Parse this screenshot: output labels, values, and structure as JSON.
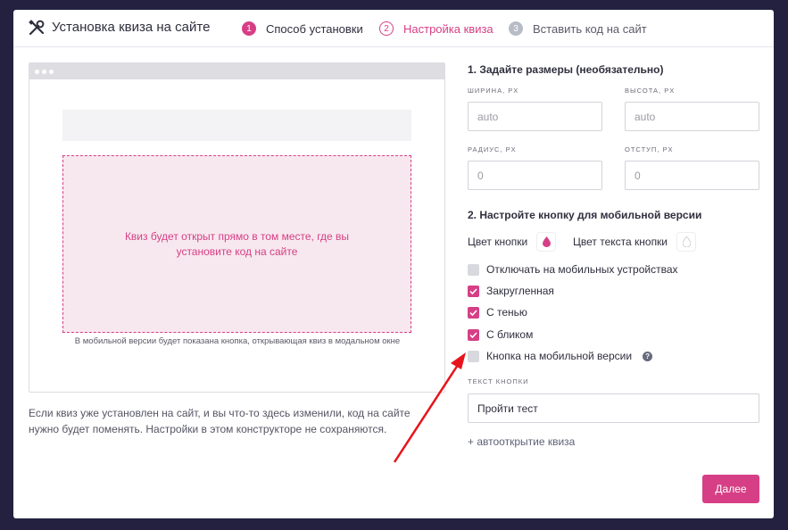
{
  "header": {
    "title": "Установка квиза на сайте",
    "steps": [
      {
        "num": "1",
        "label": "Способ установки"
      },
      {
        "num": "2",
        "label": "Настройка квиза"
      },
      {
        "num": "3",
        "label": "Вставить код на сайт"
      }
    ]
  },
  "preview": {
    "quiz_text": "Квиз будет открыт прямо в том месте, где вы установите код на сайте",
    "mobile_note": "В мобильной версии будет показана кнопка, открывающая квиз в модальном окне",
    "footer_note": "Если квиз уже установлен на сайт, и вы что-то здесь изменили, код на сайте нужно будет поменять. Настройки в этом конструкторе не сохраняются."
  },
  "sizes": {
    "title": "1. Задайте размеры (необязательно)",
    "width_label": "ширина, px",
    "width_placeholder": "auto",
    "height_label": "высота, px",
    "height_placeholder": "auto",
    "radius_label": "радиус, px",
    "radius_placeholder": "0",
    "offset_label": "отступ, px",
    "offset_placeholder": "0"
  },
  "mobile": {
    "title": "2. Настройте кнопку для мобильной версии",
    "button_color_label": "Цвет кнопки",
    "button_color": "#d63f85",
    "text_color_label": "Цвет текста кнопки",
    "text_color": "#ffffff",
    "options": [
      {
        "label": "Отключать на мобильных устройствах",
        "checked": false
      },
      {
        "label": "Закругленная",
        "checked": true
      },
      {
        "label": "С тенью",
        "checked": true
      },
      {
        "label": "С бликом",
        "checked": true
      },
      {
        "label": "Кнопка на мобильной версии",
        "checked": false
      }
    ],
    "button_text_label": "текст кнопки",
    "button_text_value": "Пройти тест",
    "autoopen_link": "+ автооткрытие квиза"
  },
  "actions": {
    "next_label": "Далее"
  },
  "colors": {
    "accent": "#d63f85",
    "arrow": "#e8141c"
  }
}
